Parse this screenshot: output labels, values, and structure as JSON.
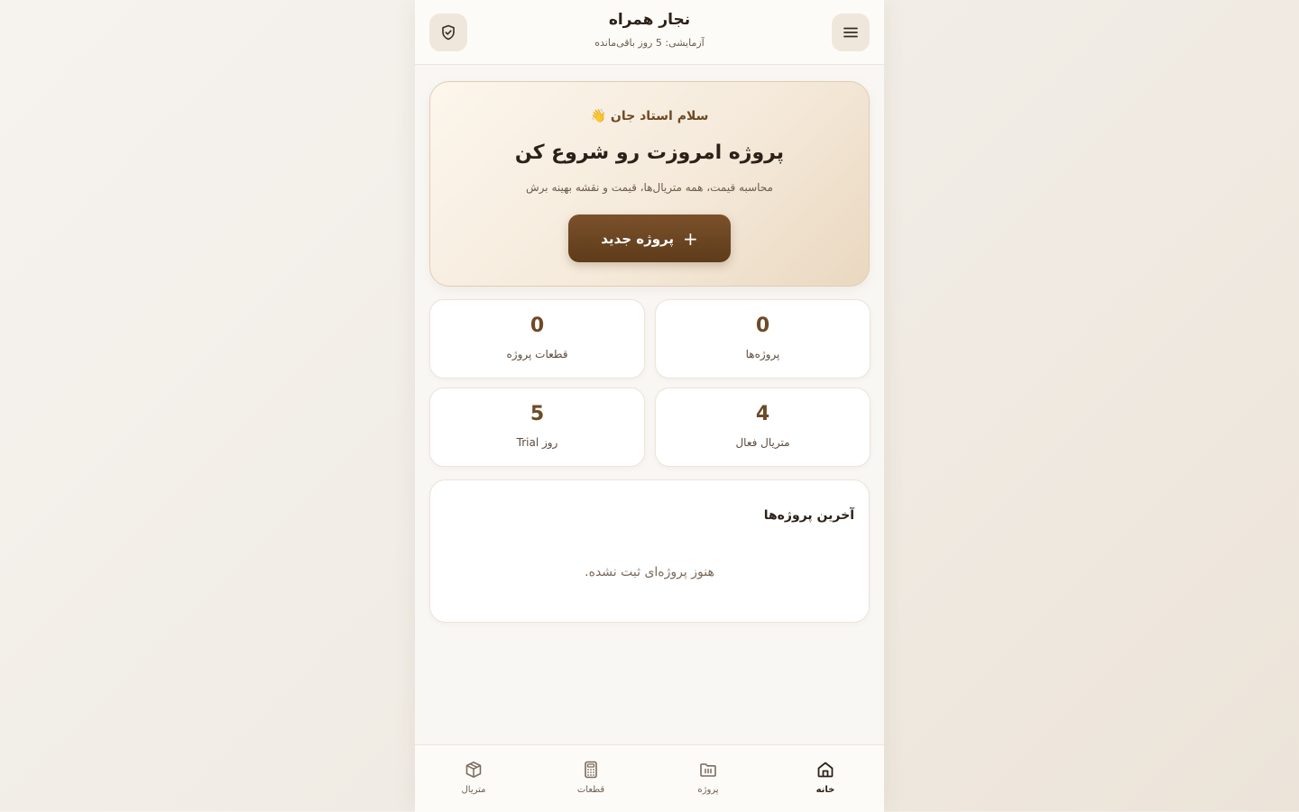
{
  "header": {
    "title": "نجار همراه",
    "subtitle": "آزمایشی: 5 روز باقی‌مانده",
    "menu_icon": "menu-icon",
    "shield_icon": "shield-check-icon"
  },
  "hero": {
    "greeting": "سلام استاد جان 👋",
    "title": "پروژه امروزت رو شروع کن",
    "description": "محاسبه قیمت، همه متریال‌ها، قیمت و نقشه بهینه برش",
    "button_label": "پروژه جدید",
    "button_icon": "plus-icon"
  },
  "stats": [
    {
      "value": "0",
      "label": "پروژه‌ها"
    },
    {
      "value": "0",
      "label": "قطعات پروژه"
    },
    {
      "value": "4",
      "label": "متریال فعال"
    },
    {
      "value": "5",
      "label": "روز Trial"
    }
  ],
  "recent": {
    "title": "آخرین پروژه‌ها",
    "empty_text": "هنوز پروژه‌ای ثبت نشده."
  },
  "nav": [
    {
      "label": "خانه",
      "icon": "home-icon",
      "active": true
    },
    {
      "label": "پروژه",
      "icon": "folder-icon",
      "active": false
    },
    {
      "label": "قطعات",
      "icon": "calculator-icon",
      "active": false
    },
    {
      "label": "متریال",
      "icon": "box-icon",
      "active": false
    }
  ],
  "colors": {
    "accent": "#6e4a25",
    "button": "#6b4623",
    "background": "#f9f7f4",
    "card": "#ffffff"
  }
}
